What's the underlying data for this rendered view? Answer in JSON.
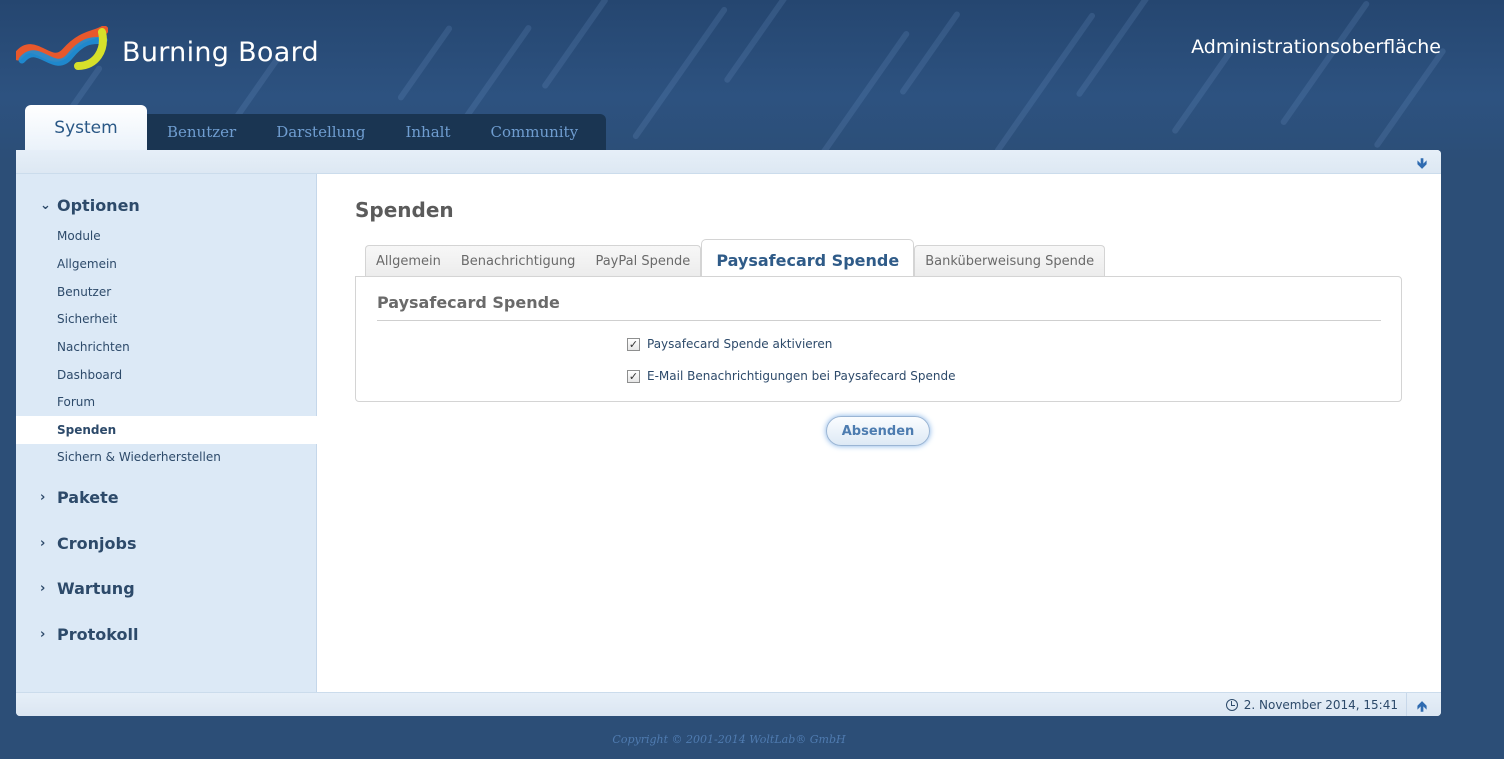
{
  "header": {
    "logo_text": "Burning Board",
    "admin_title": "Administrationsoberfläche"
  },
  "main_tabs": {
    "active": "System",
    "items": [
      "Benutzer",
      "Darstellung",
      "Inhalt",
      "Community"
    ]
  },
  "topbar": {
    "scroll_down_icon": "arrow-down-icon"
  },
  "sidebar": {
    "optionen": {
      "label": "Optionen",
      "items": [
        "Module",
        "Allgemein",
        "Benutzer",
        "Sicherheit",
        "Nachrichten",
        "Dashboard",
        "Forum",
        "Spenden",
        "Sichern & Wiederherstellen"
      ],
      "active": "Spenden"
    },
    "sections": [
      "Pakete",
      "Cronjobs",
      "Wartung",
      "Protokoll"
    ]
  },
  "content": {
    "title": "Spenden",
    "tabs": [
      "Allgemein",
      "Benachrichtigung",
      "PayPal Spende"
    ],
    "active_tab": "Paysafecard Spende",
    "tab_after": "Banküberweisung Spende",
    "panel_title": "Paysafecard Spende",
    "options": [
      {
        "label": "Paysafecard Spende aktivieren",
        "checked": true
      },
      {
        "label": "E-Mail Benachrichtigungen bei Paysafecard Spende",
        "checked": true
      }
    ],
    "submit_label": "Absenden"
  },
  "footer": {
    "datetime": "2. November 2014, 15:41",
    "copyright": "Copyright © 2001-2014 WoltLab® GmbH"
  },
  "colors": {
    "background": "#2c4e77",
    "accent": "#2f5b88",
    "sidebar": "#dce9f6"
  }
}
